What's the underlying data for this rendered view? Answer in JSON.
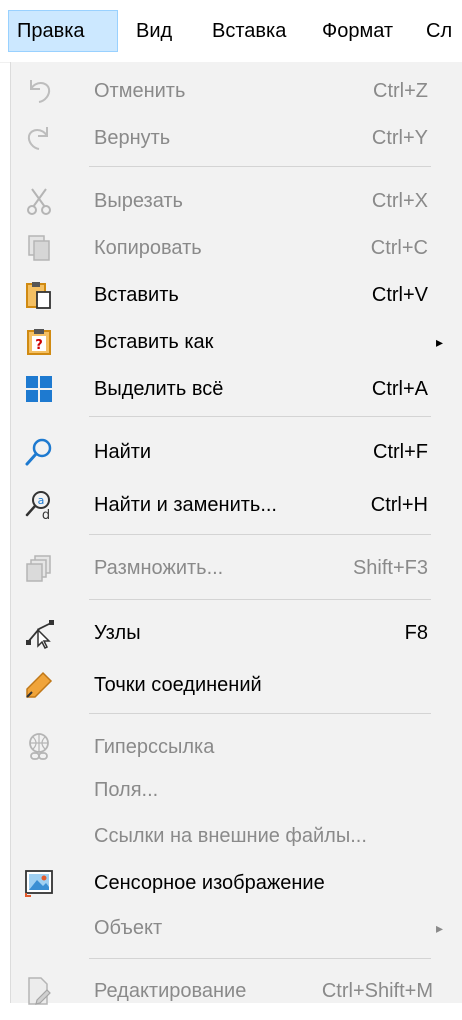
{
  "menubar": {
    "items": [
      {
        "label": "Правка",
        "active": true
      },
      {
        "label": "Вид"
      },
      {
        "label": "Вставка"
      },
      {
        "label": "Формат"
      },
      {
        "label": "Сл"
      }
    ]
  },
  "menu": {
    "items": [
      {
        "label": "Отменить",
        "shortcut": "Ctrl+Z",
        "icon": "undo-icon",
        "enabled": false
      },
      {
        "label": "Вернуть",
        "shortcut": "Ctrl+Y",
        "icon": "redo-icon",
        "enabled": false
      },
      {
        "label": "Вырезать",
        "shortcut": "Ctrl+X",
        "icon": "cut-icon",
        "enabled": false
      },
      {
        "label": "Копировать",
        "shortcut": "Ctrl+C",
        "icon": "copy-icon",
        "enabled": false
      },
      {
        "label": "Вставить",
        "shortcut": "Ctrl+V",
        "icon": "paste-icon",
        "enabled": true
      },
      {
        "label": "Вставить как",
        "icon": "paste-special-icon",
        "enabled": true,
        "submenu": true
      },
      {
        "label": "Выделить всё",
        "shortcut": "Ctrl+A",
        "icon": "select-all-icon",
        "enabled": true
      },
      {
        "label": "Найти",
        "shortcut": "Ctrl+F",
        "icon": "find-icon",
        "enabled": true
      },
      {
        "label": "Найти и заменить...",
        "shortcut": "Ctrl+H",
        "icon": "find-replace-icon",
        "enabled": true
      },
      {
        "label": "Размножить...",
        "shortcut": "Shift+F3",
        "icon": "duplicate-icon",
        "enabled": false
      },
      {
        "label": "Узлы",
        "shortcut": "F8",
        "icon": "points-icon",
        "enabled": true
      },
      {
        "label": "Точки соединений",
        "icon": "glue-points-icon",
        "enabled": true
      },
      {
        "label": "Гиперссылка",
        "icon": "hyperlink-icon",
        "enabled": false
      },
      {
        "label": "Поля...",
        "enabled": false
      },
      {
        "label": "Ссылки на внешние файлы...",
        "enabled": false
      },
      {
        "label": "Сенсорное изображение",
        "icon": "image-map-icon",
        "enabled": true
      },
      {
        "label": "Объект",
        "enabled": false,
        "submenu": true
      },
      {
        "label": "Редактирование",
        "shortcut": "Ctrl+Shift+M",
        "icon": "edit-mode-icon",
        "enabled": false
      }
    ],
    "submenu_arrow": "▸"
  },
  "colors": {
    "active_bg": "#cce8ff",
    "menu_bg": "#f2f2f2",
    "disabled_text": "#8a8a8a",
    "accent_blue": "#1e7ad0",
    "accent_orange": "#e69a1c"
  }
}
